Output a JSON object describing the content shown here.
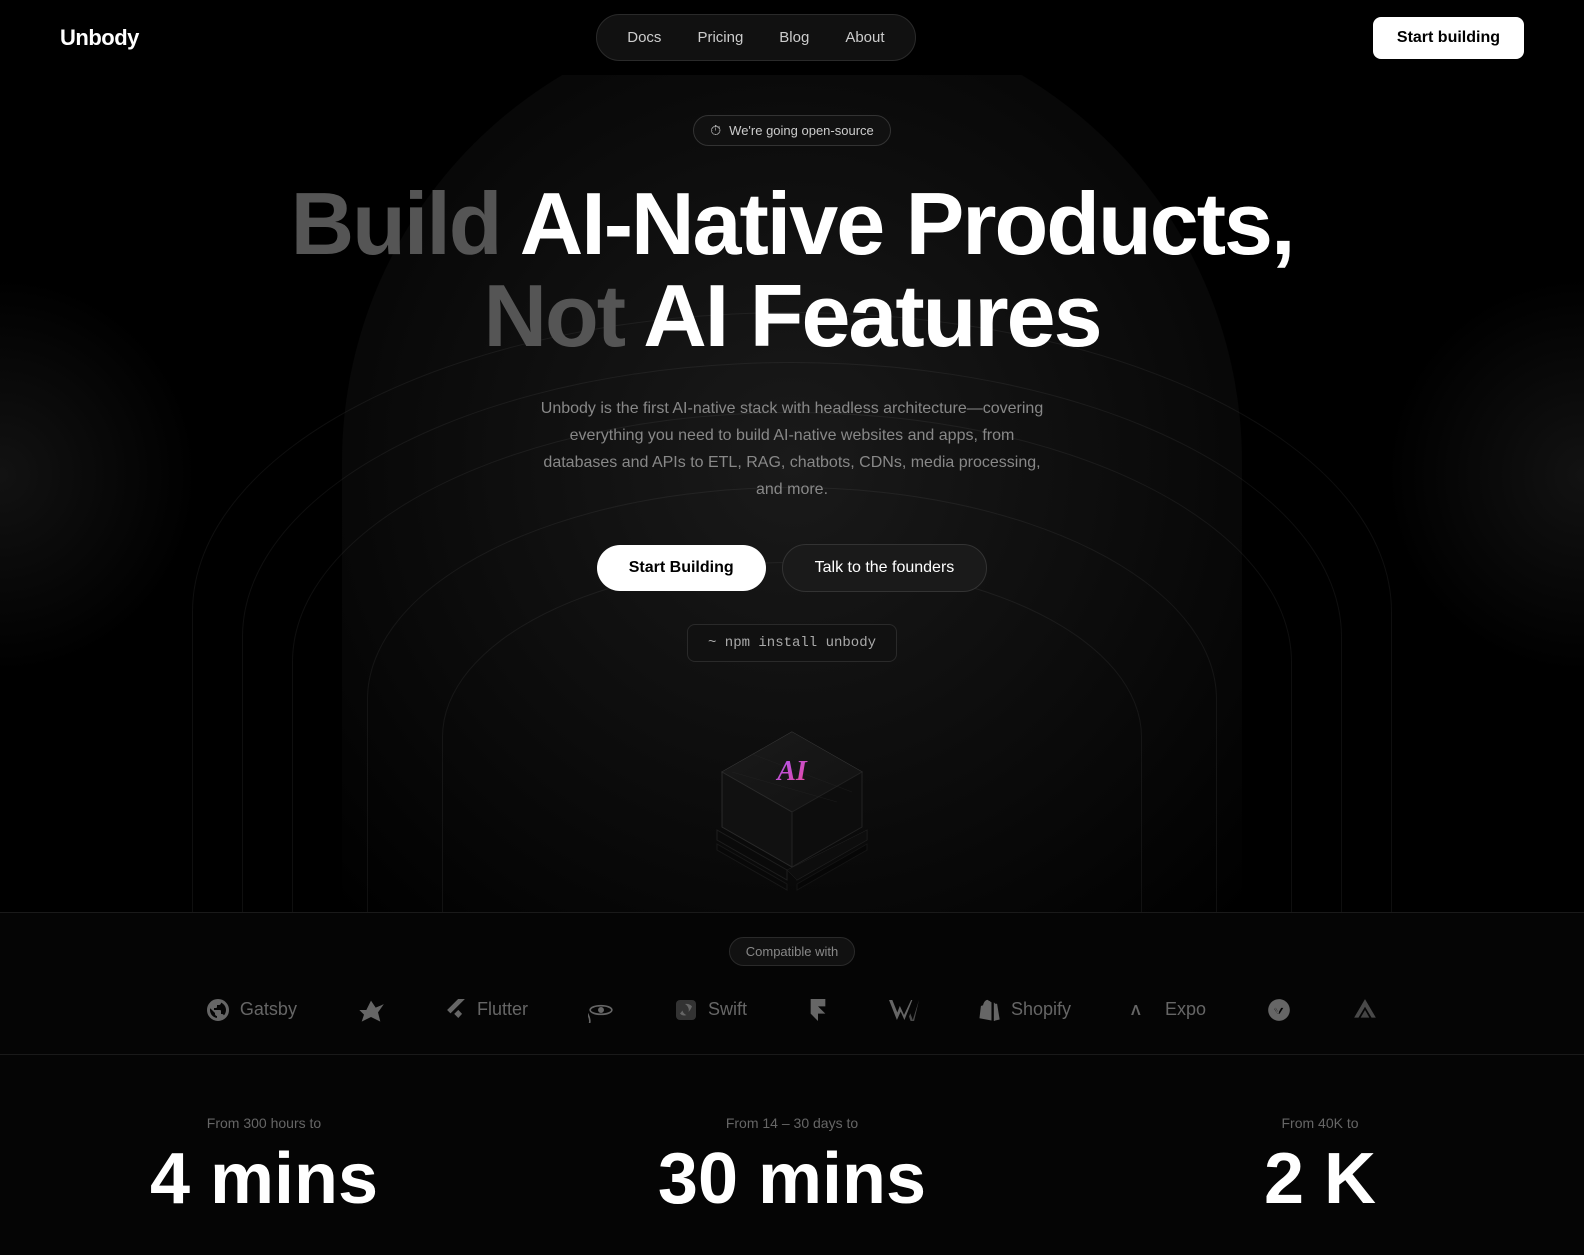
{
  "brand": {
    "name": "Unbody",
    "logo_text": "Unbody"
  },
  "navbar": {
    "links": [
      {
        "id": "docs",
        "label": "Docs"
      },
      {
        "id": "pricing",
        "label": "Pricing"
      },
      {
        "id": "blog",
        "label": "Blog"
      },
      {
        "id": "about",
        "label": "About"
      }
    ],
    "cta_label": "Start building"
  },
  "hero": {
    "badge_text": "We're going open-source",
    "title_line1_dim": "Build ",
    "title_line1_bright": "AI-Native Products,",
    "title_line2_dim": "Not ",
    "title_line2_bright": "AI Features",
    "description": "Unbody is the first AI-native stack with headless architecture—covering everything you need to build AI-native websites and apps, from databases and APIs to ETL, RAG, chatbots, CDNs, media processing, and more.",
    "btn_primary": "Start Building",
    "btn_secondary": "Talk to the founders",
    "npm_command": "~ npm install unbody"
  },
  "compatible": {
    "label": "Compatible with",
    "logos": [
      {
        "id": "gatsby",
        "name": "Gatsby",
        "symbol": "◎"
      },
      {
        "id": "unknown1",
        "name": "",
        "symbol": "🦅"
      },
      {
        "id": "flutter",
        "name": "Flutter",
        "symbol": "◀"
      },
      {
        "id": "react",
        "name": "",
        "symbol": "⚛"
      },
      {
        "id": "swift",
        "name": "Swift",
        "symbol": "▣"
      },
      {
        "id": "framer",
        "name": "",
        "symbol": "▲"
      },
      {
        "id": "webflow",
        "name": "",
        "symbol": "W"
      },
      {
        "id": "shopify",
        "name": "Shopify",
        "symbol": "🛍"
      },
      {
        "id": "expo",
        "name": "Expo",
        "symbol": "Λ"
      },
      {
        "id": "next",
        "name": "",
        "symbol": "N"
      },
      {
        "id": "astro",
        "name": "",
        "symbol": "△"
      }
    ]
  },
  "stats": [
    {
      "id": "time",
      "label": "From 300 hours to",
      "value": "4 mins"
    },
    {
      "id": "days",
      "label": "From 14 – 30 days to",
      "value": "30 mins"
    },
    {
      "id": "cost",
      "label": "From 40K to",
      "value": "2 K"
    }
  ],
  "colors": {
    "bg": "#000000",
    "surface": "#111111",
    "border": "#2a2a2a",
    "text_primary": "#ffffff",
    "text_dim": "#555555",
    "text_muted": "#888888",
    "accent_purple": "#9b59b6",
    "accent_red": "#c0392b"
  }
}
